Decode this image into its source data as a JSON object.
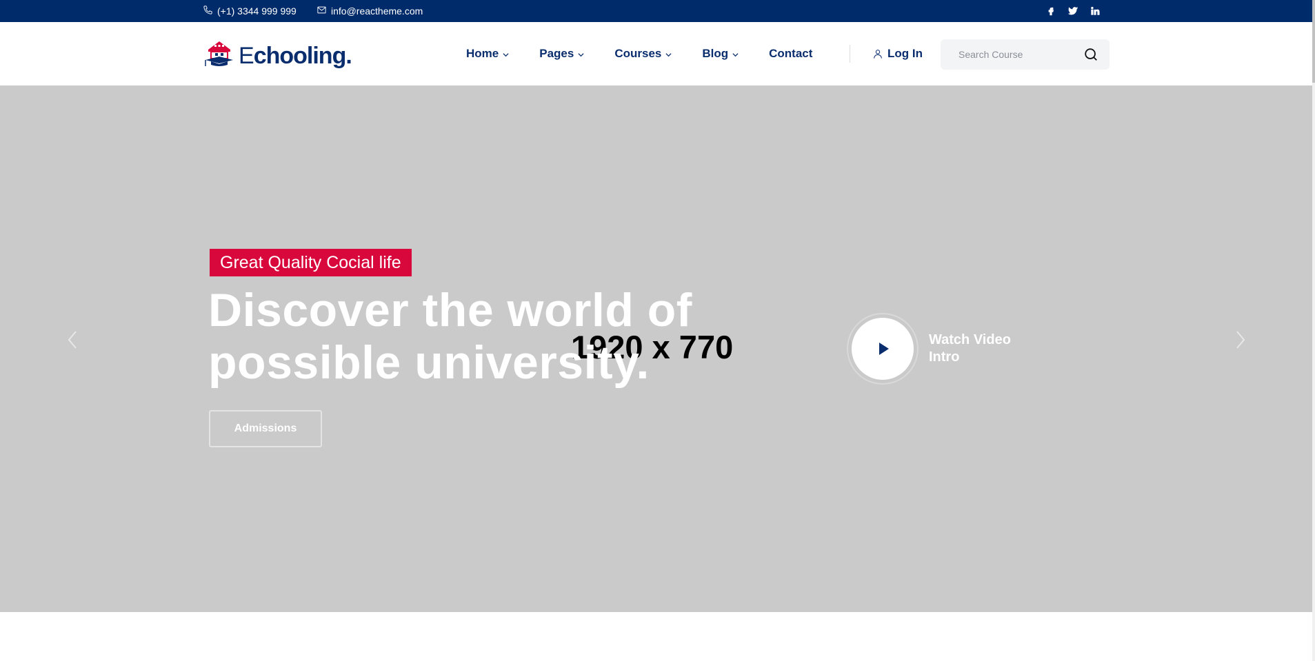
{
  "topbar": {
    "phone": "(+1) 3344 999 999",
    "email": "info@reactheme.com",
    "phone_icon": "phone-icon",
    "email_icon": "mail-icon",
    "socials": [
      "facebook-icon",
      "twitter-icon",
      "linkedin-icon"
    ]
  },
  "brand": {
    "logo_first": "E",
    "logo_rest": "chooling.",
    "primary_color": "#0a2d6e",
    "accent_color": "#d9083c"
  },
  "nav": {
    "items": [
      {
        "label": "Home",
        "has_dropdown": true
      },
      {
        "label": "Pages",
        "has_dropdown": true
      },
      {
        "label": "Courses",
        "has_dropdown": true
      },
      {
        "label": "Blog",
        "has_dropdown": true
      },
      {
        "label": "Contact",
        "has_dropdown": false
      }
    ],
    "login_label": "Log In"
  },
  "search": {
    "placeholder": "Search Course",
    "value": ""
  },
  "hero": {
    "placeholder_size": "1920 x 770",
    "badge": "Great Quality Cocial life",
    "headline_line1": "Discover the world of",
    "headline_line2": "possible university.",
    "cta_label": "Admissions",
    "video_label_line1": "Watch Video",
    "video_label_line2": "Intro"
  }
}
